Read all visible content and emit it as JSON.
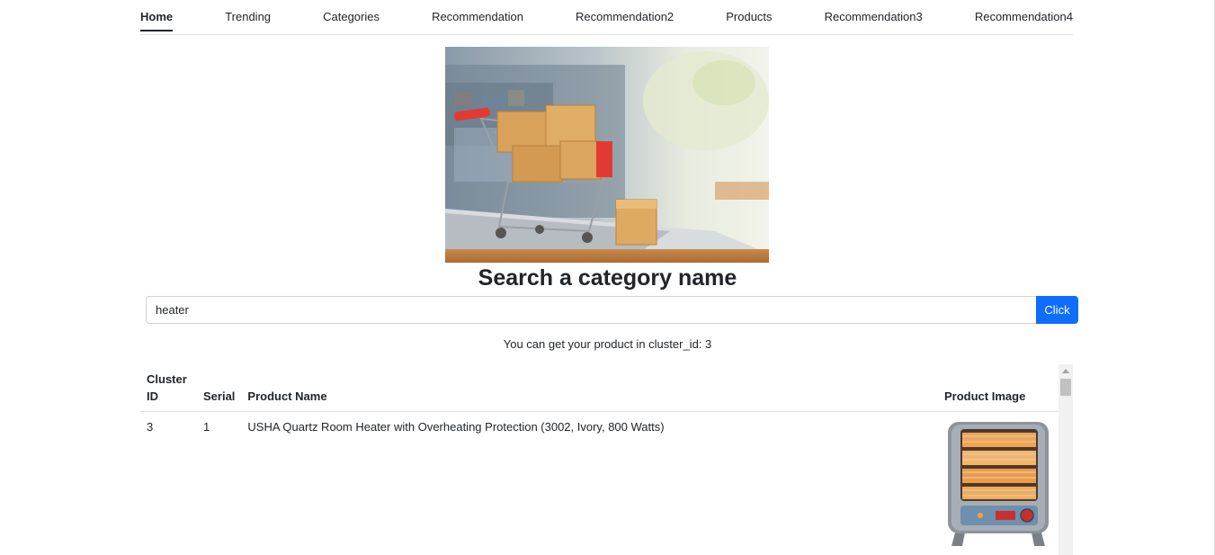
{
  "nav": {
    "items": [
      {
        "label": "Home",
        "active": true
      },
      {
        "label": "Trending"
      },
      {
        "label": "Categories"
      },
      {
        "label": "Recommendation"
      },
      {
        "label": "Recommendation2"
      },
      {
        "label": "Products"
      },
      {
        "label": "Recommendation3"
      },
      {
        "label": "Recommendation4"
      }
    ]
  },
  "hero": {
    "icon": "shopping-cart-with-boxes-on-laptop"
  },
  "heading": "Search a category name",
  "search": {
    "value": "heater",
    "button_label": "Click",
    "button_color": "#0d6efd"
  },
  "result_message": "You can get your product in cluster_id: 3",
  "table": {
    "headers": {
      "cluster_id": "Cluster ID",
      "serial": "Serial",
      "product_name": "Product Name",
      "product_image": "Product Image"
    },
    "rows": [
      {
        "cluster_id": "3",
        "serial": "1",
        "product_name": "USHA Quartz Room Heater with Overheating Protection (3002, Ivory, 800 Watts)",
        "image_icon": "room-heater-icon"
      }
    ]
  }
}
